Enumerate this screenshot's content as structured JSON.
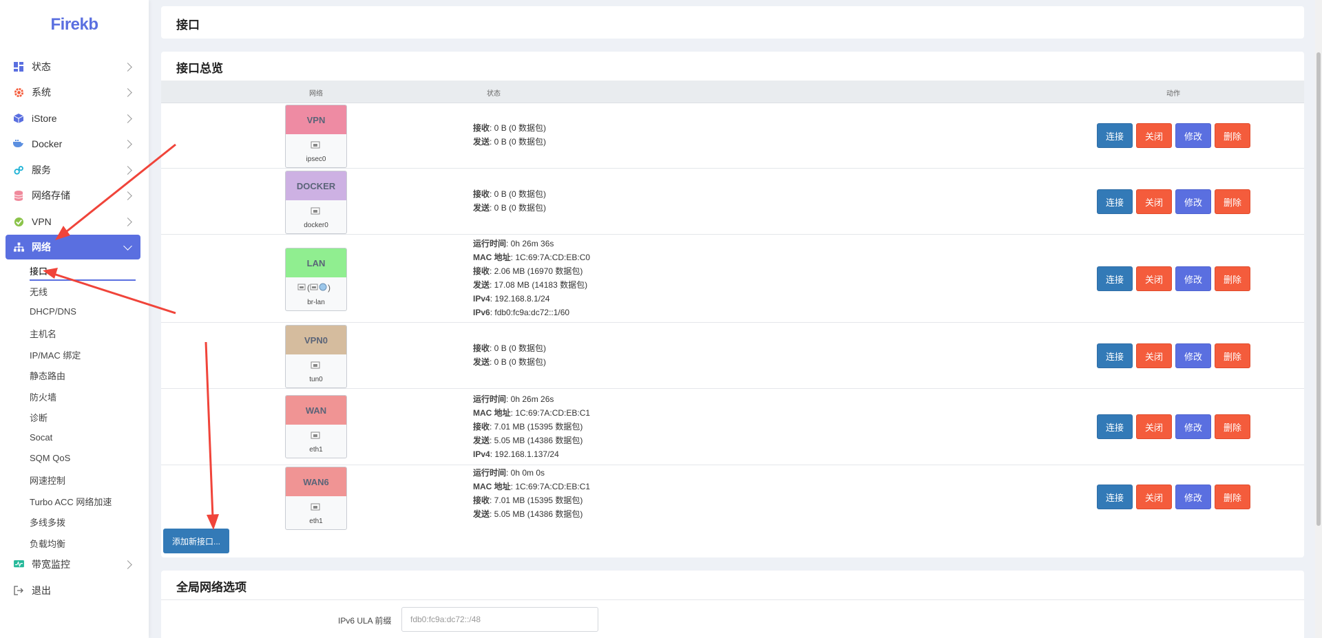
{
  "brand": {
    "logo_text": "Firekb",
    "accent_color": "#5a6fe0"
  },
  "sidebar": {
    "items": [
      {
        "label": "状态",
        "icon": "dashboard-icon"
      },
      {
        "label": "系统",
        "icon": "gear-icon"
      },
      {
        "label": "iStore",
        "icon": "cube-icon"
      },
      {
        "label": "Docker",
        "icon": "docker-whale-icon"
      },
      {
        "label": "服务",
        "icon": "services-gears-icon"
      },
      {
        "label": "网络存储",
        "icon": "storage-database-icon"
      },
      {
        "label": "VPN",
        "icon": "vpn-icon"
      },
      {
        "label": "网络",
        "icon": "network-sitemap-icon",
        "active": true
      },
      {
        "label": "带宽监控",
        "icon": "bandwidth-monitor-icon"
      },
      {
        "label": "退出",
        "icon": "logout-icon"
      }
    ],
    "network_subitems": [
      {
        "label": "接口",
        "active": true
      },
      {
        "label": "无线"
      },
      {
        "label": "DHCP/DNS"
      },
      {
        "label": "主机名"
      },
      {
        "label": "IP/MAC 绑定"
      },
      {
        "label": "静态路由"
      },
      {
        "label": "防火墙"
      },
      {
        "label": "诊断"
      },
      {
        "label": "Socat"
      },
      {
        "label": "SQM QoS"
      },
      {
        "label": "网速控制"
      },
      {
        "label": "Turbo ACC 网络加速"
      },
      {
        "label": "多线多拨"
      },
      {
        "label": "负载均衡"
      }
    ]
  },
  "page": {
    "title": "接口"
  },
  "overview": {
    "title": "接口总览",
    "headers": {
      "network": "网络",
      "status": "状态",
      "actions": "动作"
    },
    "actions": {
      "connect": "连接",
      "close": "关闭",
      "edit": "修改",
      "delete": "删除"
    },
    "interfaces": [
      {
        "name": "VPN",
        "color": "#ee8ba3",
        "device": "ipsec0",
        "status": [
          {
            "k": "接收",
            "v": ": 0 B (0 数据包)"
          },
          {
            "k": "发送",
            "v": ": 0 B (0 数据包)"
          }
        ]
      },
      {
        "name": "DOCKER",
        "color": "#cdb1e3",
        "device": "docker0",
        "status": [
          {
            "k": "接收",
            "v": ": 0 B (0 数据包)"
          },
          {
            "k": "发送",
            "v": ": 0 B (0 数据包)"
          }
        ]
      },
      {
        "name": "LAN",
        "color": "#90ee90",
        "device": "br-lan",
        "status": [
          {
            "k": "运行时间",
            "v": ": 0h 26m 36s"
          },
          {
            "k": "MAC 地址",
            "v": ": 1C:69:7A:CD:EB:C0"
          },
          {
            "k": "接收",
            "v": ": 2.06 MB (16970 数据包)"
          },
          {
            "k": "发送",
            "v": ": 17.08 MB (14183 数据包)"
          },
          {
            "k": "IPv4",
            "v": ": 192.168.8.1/24"
          },
          {
            "k": "IPv6",
            "v": ": fdb0:fc9a:dc72::1/60"
          }
        ]
      },
      {
        "name": "VPN0",
        "color": "#d5bc9e",
        "device": "tun0",
        "status": [
          {
            "k": "接收",
            "v": ": 0 B (0 数据包)"
          },
          {
            "k": "发送",
            "v": ": 0 B (0 数据包)"
          }
        ]
      },
      {
        "name": "WAN",
        "color": "#f09494",
        "device": "eth1",
        "status": [
          {
            "k": "运行时间",
            "v": ": 0h 26m 26s"
          },
          {
            "k": "MAC 地址",
            "v": ": 1C:69:7A:CD:EB:C1"
          },
          {
            "k": "接收",
            "v": ": 7.01 MB (15395 数据包)"
          },
          {
            "k": "发送",
            "v": ": 5.05 MB (14386 数据包)"
          },
          {
            "k": "IPv4",
            "v": ": 192.168.1.137/24"
          }
        ]
      },
      {
        "name": "WAN6",
        "color": "#f09494",
        "device": "eth1",
        "status": [
          {
            "k": "运行时间",
            "v": ": 0h 0m 0s"
          },
          {
            "k": "MAC 地址",
            "v": ": 1C:69:7A:CD:EB:C1"
          },
          {
            "k": "接收",
            "v": ": 7.01 MB (15395 数据包)"
          },
          {
            "k": "发送",
            "v": ": 5.05 MB (14386 数据包)"
          }
        ]
      }
    ],
    "add_button": "添加新接口..."
  },
  "global": {
    "title": "全局网络选项",
    "ipv6_ula_label": "IPv6 ULA 前缀",
    "ipv6_ula_value": "fdb0:fc9a:dc72::/48"
  }
}
